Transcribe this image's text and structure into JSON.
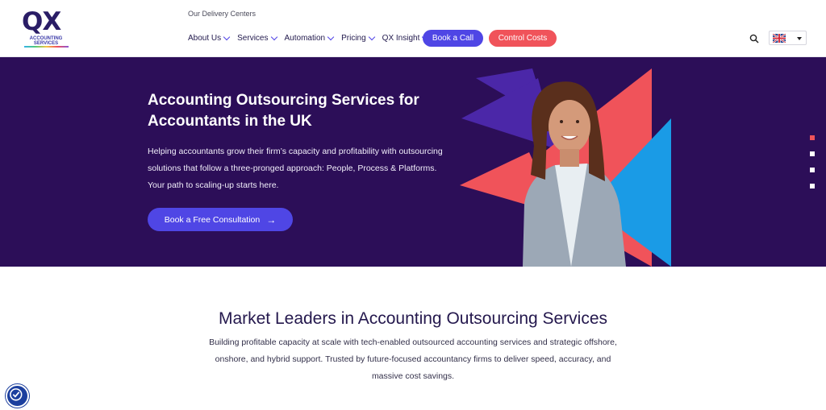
{
  "header": {
    "logo": {
      "main": "QX",
      "sub": "ACCOUNTING SERVICES"
    },
    "delivery_link": "Our Delivery Centers",
    "nav": [
      {
        "label": "About Us"
      },
      {
        "label": "Services"
      },
      {
        "label": "Automation"
      },
      {
        "label": "Pricing"
      },
      {
        "label": "QX Insight"
      }
    ],
    "book_call": "Book a Call",
    "control_costs": "Control Costs",
    "search_icon": "search-icon",
    "language_flag": "uk-flag"
  },
  "hero": {
    "title": "Accounting Outsourcing Services for Accountants in the UK",
    "description": "Helping accountants grow their firm’s capacity and profitability with outsourcing solutions that follow a three-pronged approach: People, Process & Platforms. Your path to scaling-up starts here.",
    "cta": "Book a Free Consultation",
    "cta_icon": "arrow-right-icon",
    "slider_dots": 4,
    "active_dot": 1
  },
  "market": {
    "title": "Market Leaders in Accounting Outsourcing Services",
    "description": "Building profitable capacity at scale with tech-enabled outsourced accounting services and strategic offshore, onshore, and hybrid support. Trusted by future-focused accountancy firms to deliver speed, accuracy, and massive cost savings."
  },
  "colors": {
    "hero_bg": "#2c0e58",
    "primary": "#4f46e5",
    "accent_red": "#f0535a",
    "accent_blue": "#1a9be6"
  },
  "accessibility_icon": "accessibility-icon"
}
